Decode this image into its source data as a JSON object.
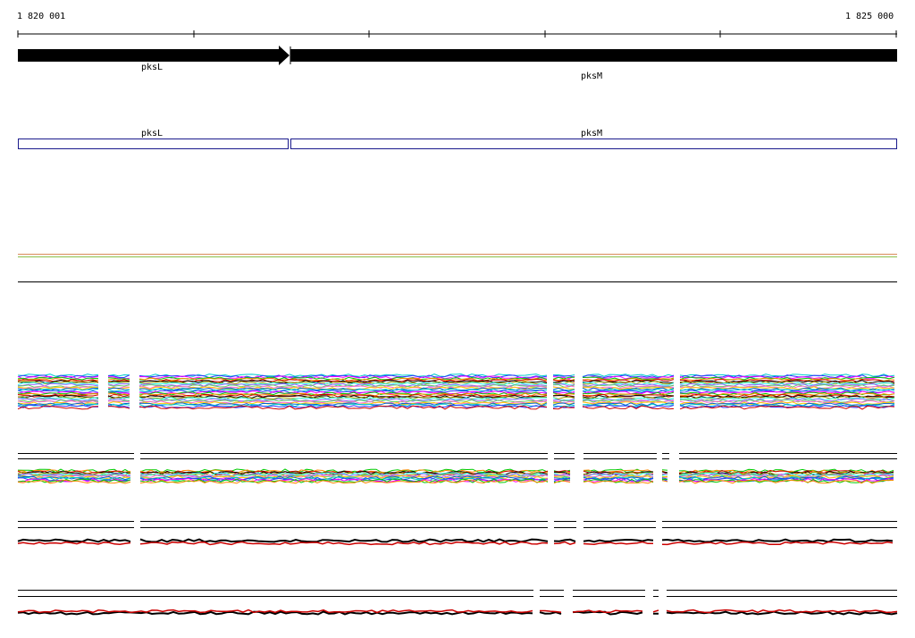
{
  "ruler": {
    "start_label": "1 820 001",
    "end_label": "1 825 000"
  },
  "genes": [
    {
      "name": "pksL",
      "strand": "+"
    },
    {
      "name": "pksM",
      "strand": "+"
    }
  ],
  "cds": [
    {
      "name": "pksL"
    },
    {
      "name": "pksM"
    }
  ],
  "colors": {
    "gene_fill": "#000000",
    "cds_outline": "#1a1a8c",
    "track_line_top": "#d98b5a",
    "track_line_bottom": "#8bbf4a",
    "reverse_strand": "#cc0000",
    "forward_strand": "#000000",
    "palette": [
      "#00cccc",
      "#3333ff",
      "#ff00ff",
      "#00cc00",
      "#ff8800",
      "#cc0000",
      "#000000",
      "#999900",
      "#33ffff",
      "#9966ff",
      "#66cc66",
      "#ff66cc",
      "#ffcc00",
      "#0066cc"
    ]
  }
}
